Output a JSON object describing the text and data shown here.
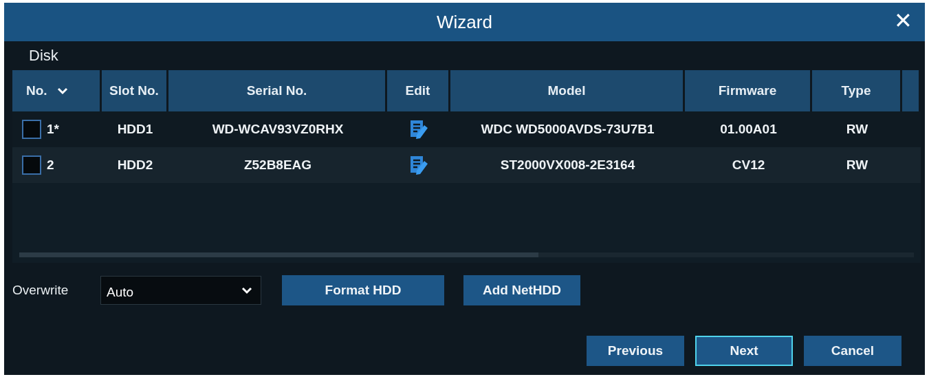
{
  "window": {
    "title": "Wizard",
    "close": "✕"
  },
  "section": "Disk",
  "table": {
    "columns": [
      {
        "label": "No.",
        "sortable": true
      },
      {
        "label": "Slot No.",
        "sortable": false
      },
      {
        "label": "Serial No.",
        "sortable": false
      },
      {
        "label": "Edit",
        "sortable": false
      },
      {
        "label": "Model",
        "sortable": false
      },
      {
        "label": "Firmware",
        "sortable": false
      },
      {
        "label": "Type",
        "sortable": false
      }
    ],
    "rows": [
      {
        "no": "1*",
        "checked": false,
        "slot": "HDD1",
        "serial": "WD-WCAV93VZ0RHX",
        "model": "WDC WD5000AVDS-73U7B1",
        "firmware": "01.00A01",
        "type": "RW"
      },
      {
        "no": "2",
        "checked": false,
        "slot": "HDD2",
        "serial": "Z52B8EAG",
        "model": "ST2000VX008-2E3164",
        "firmware": "CV12",
        "type": "RW"
      }
    ]
  },
  "overwrite": {
    "label": "Overwrite",
    "value": "Auto"
  },
  "actions": [
    {
      "label": "Format HDD"
    },
    {
      "label": "Add NetHDD"
    }
  ],
  "footer_buttons": [
    {
      "label": "Previous",
      "focused": false
    },
    {
      "label": "Next",
      "focused": true
    },
    {
      "label": "Cancel",
      "focused": false
    }
  ]
}
